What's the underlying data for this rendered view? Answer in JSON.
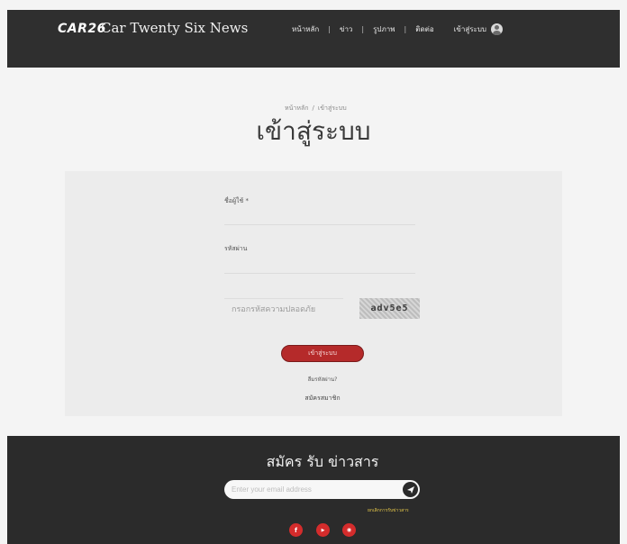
{
  "header": {
    "logo": "CAR26",
    "site_title": "Car Twenty Six News",
    "nav": [
      {
        "label": "หน้าหลัก"
      },
      {
        "label": "ข่าว"
      },
      {
        "label": "รูปภาพ"
      },
      {
        "label": "ติดต่อ"
      }
    ],
    "login_label": "เข้าสู่ระบบ"
  },
  "breadcrumb": {
    "home": "หน้าหลัก",
    "current": "เข้าสู่ระบบ"
  },
  "page_title": "เข้าสู่ระบบ",
  "form": {
    "username_label": "ชื่อผู้ใช้ *",
    "username_value": "",
    "password_label": "รหัสผ่าน",
    "password_value": "",
    "captcha_placeholder": "กรอกรหัสความปลอดภัย",
    "captcha_text": "adv5e5",
    "login_button": "เข้าสู่ระบบ",
    "forgot_password": "ลืมรหัสผ่าน?",
    "register": "สมัครสมาชิก"
  },
  "footer": {
    "title": "สมัคร รับ ข่าวสาร",
    "email_placeholder": "Enter your email address",
    "cancel_subscription": "ยกเลิกการรับข่าวสาร",
    "social": [
      {
        "icon": "facebook-icon",
        "glyph": "f"
      },
      {
        "icon": "youtube-icon",
        "glyph": "▶"
      },
      {
        "icon": "line-icon",
        "glyph": "◉"
      }
    ]
  },
  "colors": {
    "header_bg": "#2f2f2f",
    "footer_bg": "#2b2b2b",
    "accent_red": "#b52a2a",
    "link_yellow": "#e6c84a"
  }
}
